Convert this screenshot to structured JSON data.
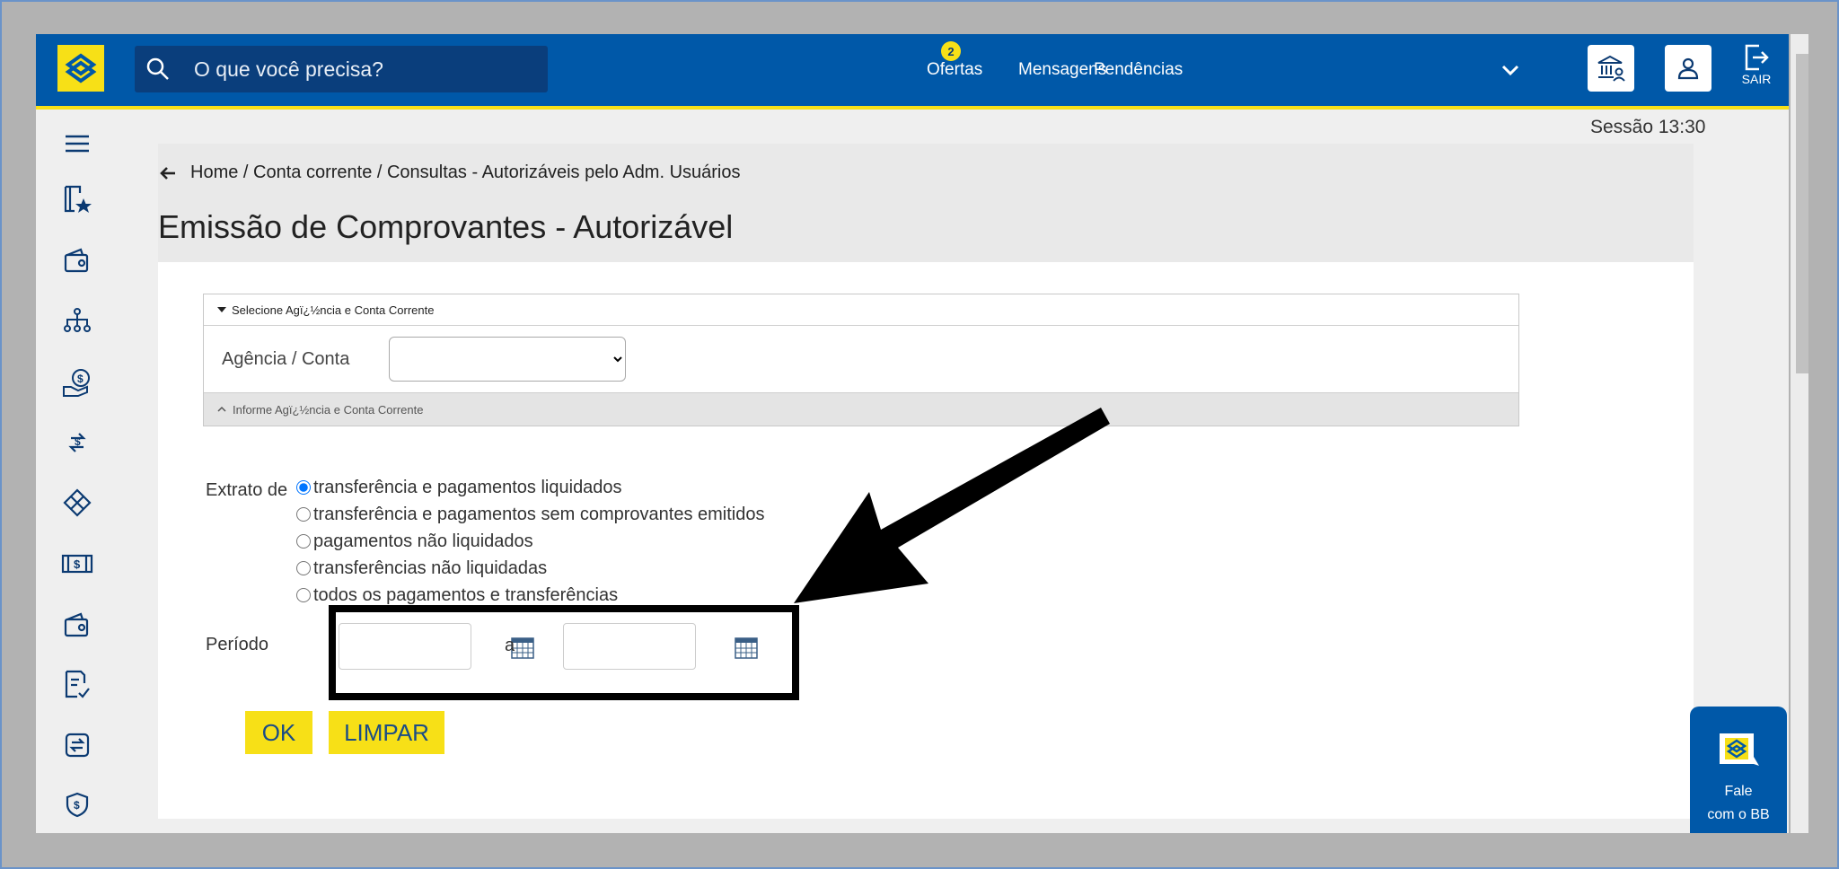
{
  "header": {
    "search_placeholder": "O que você precisa?",
    "nav": {
      "ofertas": "Ofertas",
      "ofertas_badge": "2",
      "mensagens": "Mensagens",
      "pendencias": "Pendências"
    },
    "sair_label": "SAIR"
  },
  "session": "Sessão 13:30",
  "breadcrumb": "Home / Conta corrente / Consultas - Autorizáveis pelo Adm. Usuários",
  "page_title": "Emissão de Comprovantes - Autorizável",
  "account_section": {
    "header": "Selecione Agï¿½ncia e Conta Corrente",
    "field_label": "Agência / Conta",
    "selected_value": "",
    "footer": "Informe Agï¿½ncia e Conta Corrente"
  },
  "extrato": {
    "label": "Extrato de",
    "options": [
      "transferência e pagamentos liquidados",
      "transferência e pagamentos sem comprovantes emitidos",
      "pagamentos não liquidados",
      "transferências não liquidadas",
      "todos os pagamentos e transferências"
    ],
    "selected_index": 0
  },
  "periodo": {
    "label": "Período",
    "separator": "a",
    "start_value": "",
    "end_value": ""
  },
  "buttons": {
    "ok": "OK",
    "limpar": "LIMPAR"
  },
  "chat": {
    "line1": "Fale",
    "line2": "com o BB"
  },
  "colors": {
    "brand_blue": "#0058a8",
    "brand_yellow": "#f7e017"
  }
}
